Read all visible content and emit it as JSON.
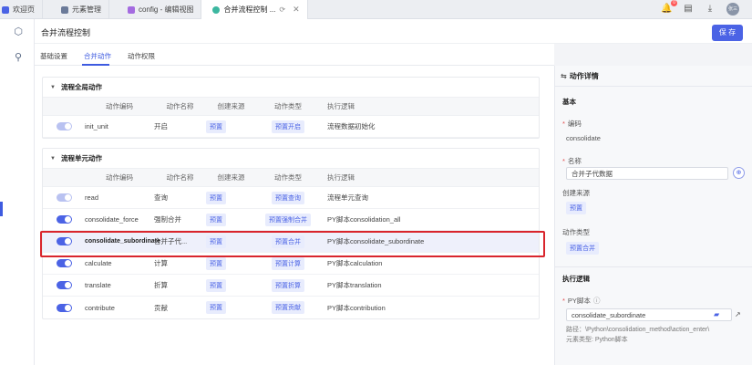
{
  "tabs": [
    {
      "label": "欢迎页",
      "color": "#4b63e5"
    },
    {
      "label": "元素管理",
      "color": "#6b7a99"
    },
    {
      "label": "config - 编辑视图",
      "color": "#a46be0"
    },
    {
      "label": "合并流程控制 ...",
      "color": "#3cb7a0"
    }
  ],
  "topbar": {
    "notification_count": "0",
    "avatar_text": "张三"
  },
  "page": {
    "title": "合并流程控制",
    "save_label": "保 存"
  },
  "subtabs": [
    "基础设置",
    "合并动作",
    "动作权限"
  ],
  "global_section": {
    "title": "流程全局动作",
    "columns": [
      "动作编码",
      "动作名称",
      "创建来源",
      "动作类型",
      "执行逻辑"
    ],
    "rows": [
      {
        "code": "init_unit",
        "name": "开启",
        "source": "预置",
        "type": "预置开启",
        "logic": "流程数据初始化",
        "enabled": false
      }
    ]
  },
  "unit_section": {
    "title": "流程单元动作",
    "columns": [
      "动作编码",
      "动作名称",
      "创建来源",
      "动作类型",
      "执行逻辑"
    ],
    "rows": [
      {
        "code": "read",
        "name": "查询",
        "source": "预置",
        "type": "预置查询",
        "logic": "流程单元查询",
        "enabled": false
      },
      {
        "code": "consolidate_force",
        "name": "强制合并",
        "source": "预置",
        "type": "预置强制合并",
        "logic": "PY脚本consolidation_all",
        "enabled": true
      },
      {
        "code": "consolidate_subordinate",
        "name": "合并子代...",
        "source": "预置",
        "type": "预置合并",
        "logic": "PY脚本consolidate_subordinate",
        "enabled": true
      },
      {
        "code": "calculate",
        "name": "计算",
        "source": "预置",
        "type": "预置计算",
        "logic": "PY脚本calculation",
        "enabled": true
      },
      {
        "code": "translate",
        "name": "折算",
        "source": "预置",
        "type": "预置折算",
        "logic": "PY脚本translation",
        "enabled": true
      },
      {
        "code": "contribute",
        "name": "贡献",
        "source": "预置",
        "type": "预置贡献",
        "logic": "PY脚本contribution",
        "enabled": true
      }
    ]
  },
  "detail": {
    "title": "动作详情",
    "basic_title": "基本",
    "code_label": "编码",
    "code_value": "consolidate",
    "name_label": "名称",
    "name_value": "合并子代数据",
    "source_label": "创建来源",
    "source_value": "预置",
    "type_label": "动作类型",
    "type_value": "预置合并",
    "logic_title": "执行逻辑",
    "script_label": "PY脚本",
    "script_value": "consolidate_subordinate",
    "path_text": "路径：\\Python\\consolidation_method\\action_enter\\",
    "element_type_text": "元素类型: Python脚本"
  }
}
